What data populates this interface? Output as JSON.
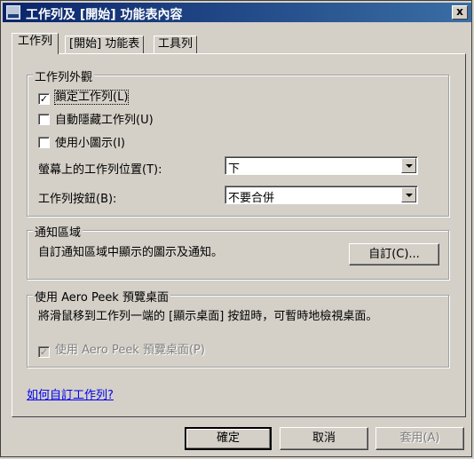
{
  "window": {
    "title": "工作列及 [開始] 功能表內容",
    "close_label": "x"
  },
  "tabs": [
    {
      "label": "工作列"
    },
    {
      "label": "[開始] 功能表"
    },
    {
      "label": "工具列"
    }
  ],
  "appearance": {
    "legend": "工作列外觀",
    "lock": {
      "label": "鎖定工作列(L)",
      "checked": true,
      "check_mark": "✓"
    },
    "autohide": {
      "label": "自動隱藏工作列(U)",
      "checked": false
    },
    "small_icons": {
      "label": "使用小圖示(I)",
      "checked": false
    },
    "location": {
      "label": "螢幕上的工作列位置(T):",
      "value": "下"
    },
    "buttons": {
      "label": "工作列按鈕(B):",
      "value": "不要合併"
    }
  },
  "notification": {
    "legend": "通知區域",
    "description": "自訂通知區域中顯示的圖示及通知。",
    "customize_label": "自訂(C)..."
  },
  "peek": {
    "legend": "使用 Aero Peek 預覽桌面",
    "description": "將滑鼠移到工作列一端的 [顯示桌面] 按鈕時，可暫時地檢視桌面。",
    "checkbox": {
      "label": "使用 Aero Peek 預覽桌面(P)",
      "checked": true,
      "check_mark": "✓"
    }
  },
  "help_link": "如何自訂工作列?",
  "footer": {
    "ok_label": "確定",
    "cancel_label": "取消",
    "apply_label": "套用(A)"
  }
}
